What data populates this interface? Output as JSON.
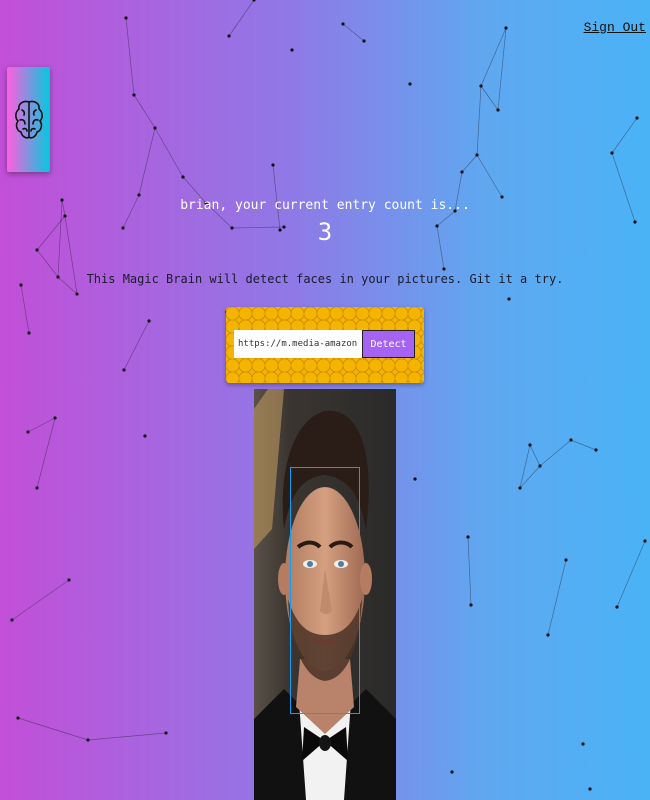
{
  "nav": {
    "sign_out_label": "Sign Out"
  },
  "logo": {
    "icon": "brain-icon",
    "colors": [
      "#ff5edf",
      "#04c8de"
    ]
  },
  "rank": {
    "message": "brian, your current entry count is...",
    "count": "3"
  },
  "image_form": {
    "tagline": "This Magic Brain will detect faces in your pictures. Git it a try.",
    "url_value": "https://m.media-amazon.com/images/M/",
    "detect_label": "Detect",
    "panel_color": "#f4b400",
    "button_color": "#a463f2"
  },
  "face_recognition": {
    "box_color": "#149df2",
    "faces_detected": 1
  },
  "theme": {
    "gradient": [
      "#c24fd8",
      "#4ab3f6"
    ]
  }
}
